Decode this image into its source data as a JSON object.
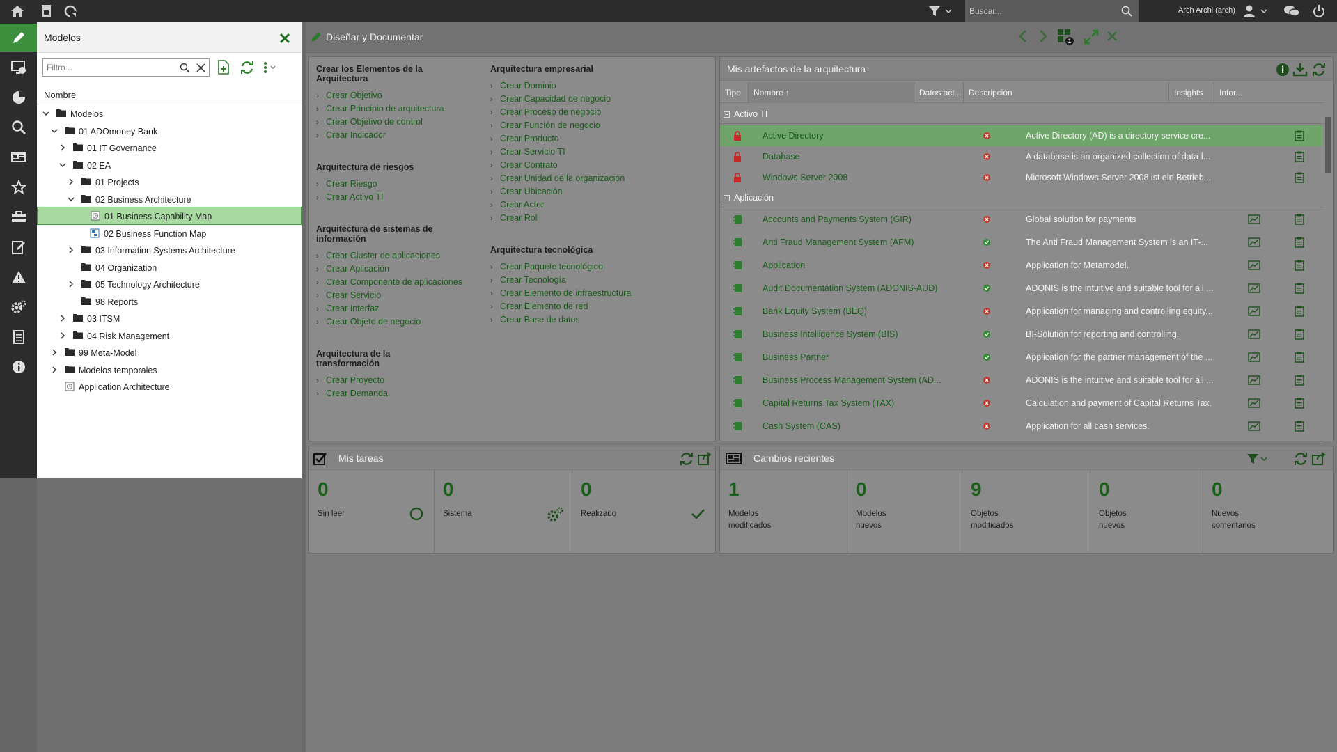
{
  "topbar": {
    "search_placeholder": "Buscar...",
    "user_label": "Arch Archi (arch)"
  },
  "models": {
    "title": "Modelos",
    "filter_placeholder": "Filtro...",
    "column_header": "Nombre",
    "tree": [
      {
        "label": "Modelos",
        "expanded": true,
        "icon": "folder-icon"
      },
      {
        "label": "01 ADOmoney Bank",
        "expanded": true,
        "icon": "folder-icon"
      },
      {
        "label": "01 IT Governance",
        "expanded": false,
        "icon": "folder-icon"
      },
      {
        "label": "02 EA",
        "expanded": true,
        "icon": "folder-icon"
      },
      {
        "label": "01 Projects",
        "expanded": false,
        "icon": "folder-icon"
      },
      {
        "label": "02 Business Architecture",
        "expanded": true,
        "icon": "folder-icon"
      },
      {
        "label": "01 Business Capability Map",
        "icon": "model-icon",
        "selected": true
      },
      {
        "label": "02 Business Function Map",
        "icon": "diagram-icon"
      },
      {
        "label": "03 Information Systems Architecture",
        "expanded": false,
        "icon": "folder-icon"
      },
      {
        "label": "04 Organization",
        "icon": "folder-icon"
      },
      {
        "label": "05 Technology Architecture",
        "expanded": false,
        "icon": "folder-icon"
      },
      {
        "label": "98 Reports",
        "icon": "folder-icon"
      },
      {
        "label": "03 ITSM",
        "expanded": false,
        "icon": "folder-icon"
      },
      {
        "label": "04 Risk Management",
        "expanded": false,
        "icon": "folder-icon"
      },
      {
        "label": "99 Meta-Model",
        "expanded": false,
        "icon": "folder-icon"
      },
      {
        "label": "Modelos temporales",
        "expanded": false,
        "icon": "folder-icon"
      },
      {
        "label": "Application Architecture",
        "icon": "model-icon"
      }
    ]
  },
  "main": {
    "title": "Diseñar y Documentar"
  },
  "create": {
    "col1": [
      {
        "heading": "Crear los Elementos de la Arquitectura",
        "links": [
          "Crear Objetivo",
          "Crear Principio de arquitectura",
          "Crear Objetivo de control",
          "Crear Indicador"
        ]
      },
      {
        "heading": "Arquitectura de riesgos",
        "links": [
          "Crear Riesgo",
          "Crear Activo TI"
        ]
      },
      {
        "heading": "Arquitectura de sistemas de información",
        "links": [
          "Crear Cluster de aplicaciones",
          "Crear Aplicación",
          "Crear Componente de aplicaciones",
          "Crear Servicio",
          "Crear Interfaz",
          "Crear Objeto de negocio"
        ]
      },
      {
        "heading": "Arquitectura de la transformación",
        "links": [
          "Crear Proyecto",
          "Crear Demanda"
        ]
      }
    ],
    "col2": [
      {
        "heading": "Arquitectura empresarial",
        "links": [
          "Crear Dominio",
          "Crear Capacidad de negocio",
          "Crear Proceso de negocio",
          "Crear Función de negocio",
          "Crear Producto",
          "Crear Servicio TI",
          "Crear Contrato",
          "Crear Unidad de la organización",
          "Crear Ubicación",
          "Crear Actor",
          "Crear Rol"
        ]
      },
      {
        "heading": "Arquitectura tecnológica",
        "links": [
          "Crear Paquete tecnológico",
          "Crear Tecnología",
          "Crear Elemento de infraestructura",
          "Crear Elemento de red",
          "Crear Base de datos"
        ]
      }
    ]
  },
  "artifacts": {
    "title": "Mis artefactos de la arquitectura",
    "columns": [
      "Tipo",
      "Nombre ↑",
      "Datos act...",
      "Descripción",
      "Insights",
      "Infor..."
    ],
    "groups": [
      {
        "label": "Activo TI",
        "rows": [
          {
            "name": "Active Directory",
            "status": "red",
            "desc": "Active Directory (AD) is a directory service cre...",
            "type_icon": "lock-icon",
            "insight": false,
            "selected": true
          },
          {
            "name": "Database",
            "status": "red",
            "desc": "A database is an organized collection of data f...",
            "type_icon": "lock-icon",
            "insight": false
          },
          {
            "name": "Windows Server 2008",
            "status": "red",
            "desc": "Microsoft Windows Server 2008 ist ein Betrieb...",
            "type_icon": "lock-icon",
            "insight": false
          }
        ]
      },
      {
        "label": "Aplicación",
        "rows": [
          {
            "name": "Accounts and Payments System (GIR)",
            "status": "red",
            "desc": "Global solution for payments",
            "type_icon": "application-icon",
            "insight": true
          },
          {
            "name": "Anti Fraud Management System (AFM)",
            "status": "green",
            "desc": "The Anti Fraud Management System is an IT-...",
            "type_icon": "application-icon",
            "insight": true
          },
          {
            "name": "Application",
            "status": "red",
            "desc": "Application for Metamodel.",
            "type_icon": "application-icon",
            "insight": true
          },
          {
            "name": "Audit Documentation System (ADONIS-AUD)",
            "status": "green",
            "desc": "ADONIS is the intuitive and suitable tool for all ...",
            "type_icon": "application-icon",
            "insight": true
          },
          {
            "name": "Bank Equity System (BEQ)",
            "status": "red",
            "desc": "Application for managing and controlling equity...",
            "type_icon": "application-icon",
            "insight": true
          },
          {
            "name": "Business Intelligence System (BIS)",
            "status": "green",
            "desc": "BI-Solution for reporting and controlling.",
            "type_icon": "application-icon",
            "insight": true
          },
          {
            "name": "Business Partner",
            "status": "green",
            "desc": "Application for the partner management of the ...",
            "type_icon": "application-icon",
            "insight": true
          },
          {
            "name": "Business Process Management System (AD...",
            "status": "red",
            "desc": "ADONIS is the intuitive and suitable tool for all ...",
            "type_icon": "application-icon",
            "insight": true
          },
          {
            "name": "Capital Returns Tax System (TAX)",
            "status": "red",
            "desc": "Calculation and payment of Capital Returns Tax.",
            "type_icon": "application-icon",
            "insight": true
          },
          {
            "name": "Cash System (CAS)",
            "status": "red",
            "desc": "Application for all cash services.",
            "type_icon": "application-icon",
            "insight": true
          }
        ]
      }
    ]
  },
  "tasks": {
    "title": "Mis tareas",
    "cells": [
      {
        "value": "0",
        "caption": "Sin leer",
        "icon": "circle-icon"
      },
      {
        "value": "0",
        "caption": "Sistema",
        "icon": "gears-icon"
      },
      {
        "value": "0",
        "caption": "Realizado",
        "icon": "check-icon"
      }
    ]
  },
  "recent": {
    "title": "Cambios recientes",
    "cells": [
      {
        "value": "1",
        "line1": "Modelos",
        "line2": "modificados"
      },
      {
        "value": "0",
        "line1": "Modelos",
        "line2": "nuevos"
      },
      {
        "value": "9",
        "line1": "Objetos",
        "line2": "modificados"
      },
      {
        "value": "0",
        "line1": "Objetos",
        "line2": "nuevos"
      },
      {
        "value": "0",
        "line1": "Nuevos",
        "line2": "comentarios"
      }
    ]
  },
  "colors": {
    "accent_green": "#3d8f3d",
    "link_green": "#1a5c1a",
    "status_red": "#c0392b",
    "status_green": "#2e8b2e"
  }
}
